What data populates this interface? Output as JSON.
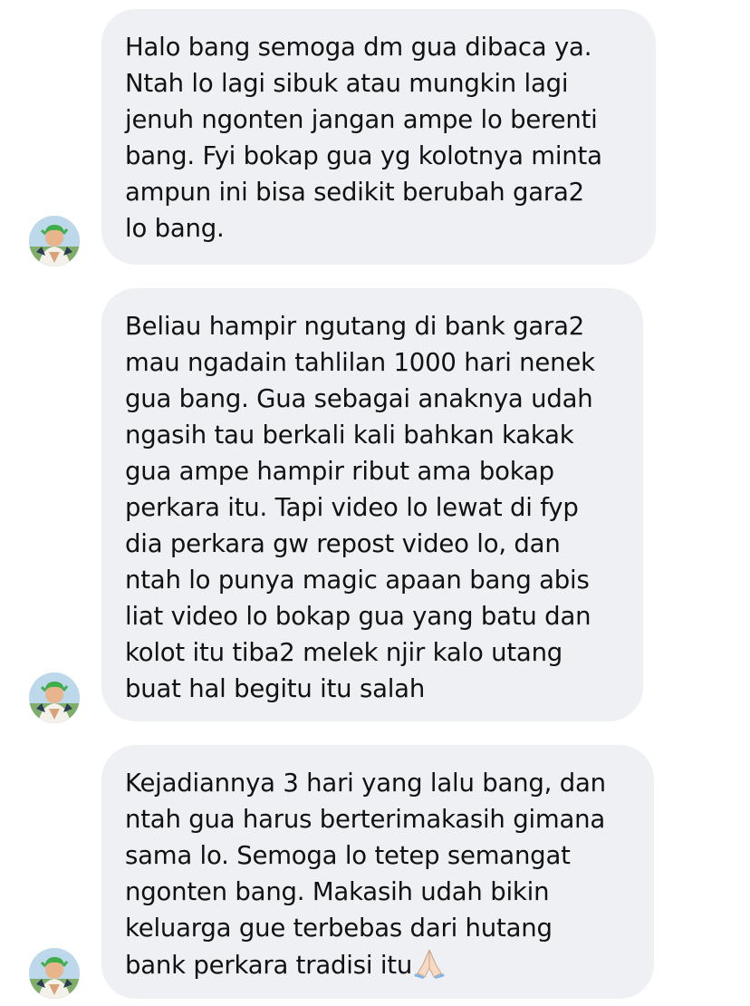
{
  "messages": [
    {
      "text": "Halo bang semoga dm gua dibaca ya.\nNtah lo lagi sibuk atau mungkin lagi\njenuh ngonten jangan ampe lo berenti\nbang. Fyi bokap gua yg kolotnya minta\nampun ini bisa sedikit berubah gara2\nlo bang."
    },
    {
      "text": "Beliau hampir ngutang di bank gara2\nmau ngadain tahlilan 1000 hari nenek\ngua bang. Gua sebagai anaknya udah\nngasih tau berkali kali bahkan kakak\ngua ampe hampir ribut ama bokap\nperkara itu. Tapi video lo lewat di fyp\ndia perkara gw repost video lo, dan\nntah lo punya magic apaan bang abis\nliat video lo bokap gua yang batu dan\nkolot itu tiba2 melek njir kalo utang\nbuat hal begitu itu salah"
    },
    {
      "text": "Kejadiannya 3 hari yang lalu bang, dan\nntah gua harus berterimakasih gimana\nsama lo. Semoga lo tetep semangat\nngonten bang. Makasih udah bikin\nkeluarga gue terbebas dari hutang\nbank perkara tradisi itu",
      "trailing_emoji": "folded-hands-emoji"
    }
  ],
  "avatar_icon": "profile-avatar-green-hair-character",
  "colors": {
    "bubble_bg": "#eef0f4",
    "text": "#111111",
    "background": "#ffffff"
  }
}
